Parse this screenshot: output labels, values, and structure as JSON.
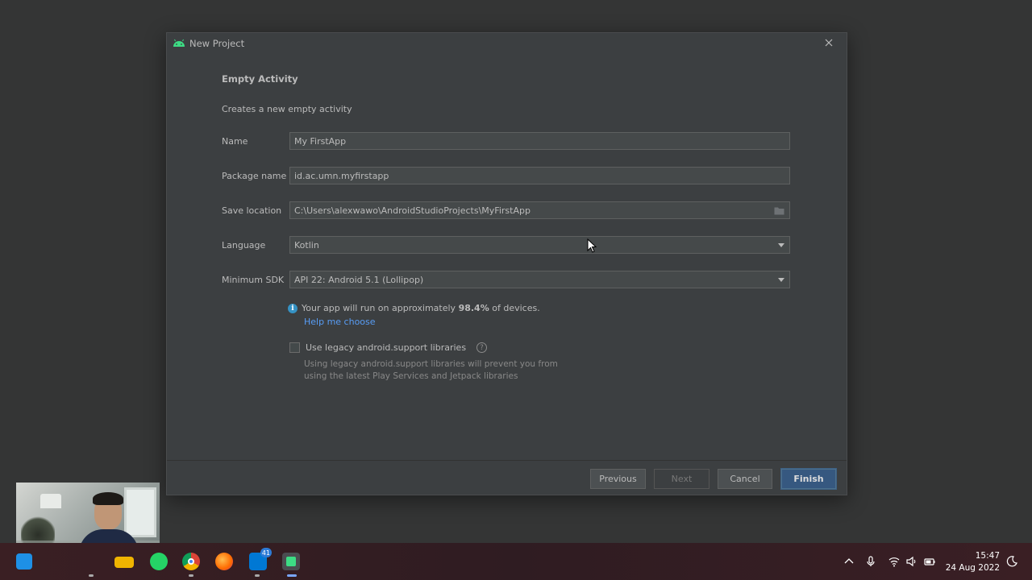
{
  "dialog": {
    "title": "New Project",
    "section_title": "Empty Activity",
    "section_desc": "Creates a new empty activity"
  },
  "form": {
    "name_label": "Name",
    "name_value": "My FirstApp",
    "package_label": "Package name",
    "package_value": "id.ac.umn.myfirstapp",
    "save_label": "Save location",
    "save_value": "C:\\Users\\alexwawo\\AndroidStudioProjects\\MyFirstApp",
    "language_label": "Language",
    "language_value": "Kotlin",
    "sdk_label": "Minimum SDK",
    "sdk_value": "API 22: Android 5.1 (Lollipop)"
  },
  "info": {
    "prefix": "Your app will run on approximately",
    "percent": "98.4%",
    "suffix": "of devices.",
    "help_link": "Help me choose"
  },
  "legacy": {
    "label": "Use legacy android.support libraries",
    "checked": false,
    "desc": "Using legacy android.support libraries will prevent you from using the latest Play Services and Jetpack libraries"
  },
  "buttons": {
    "previous": "Previous",
    "next": "Next",
    "cancel": "Cancel",
    "finish": "Finish"
  },
  "taskbar": {
    "mail_badge": "41",
    "time": "15:47",
    "date": "24 Aug 2022"
  },
  "colors": {
    "dialog_bg": "#3c3f41",
    "field_bg": "#45494a",
    "primary_button": "#365880",
    "link": "#589df6",
    "info_icon": "#3592c4",
    "android_green": "#3ddc84"
  },
  "icons": {
    "title": "android-icon",
    "close": "close-icon",
    "folder": "folder-icon",
    "info": "info-icon",
    "help": "question-icon"
  }
}
